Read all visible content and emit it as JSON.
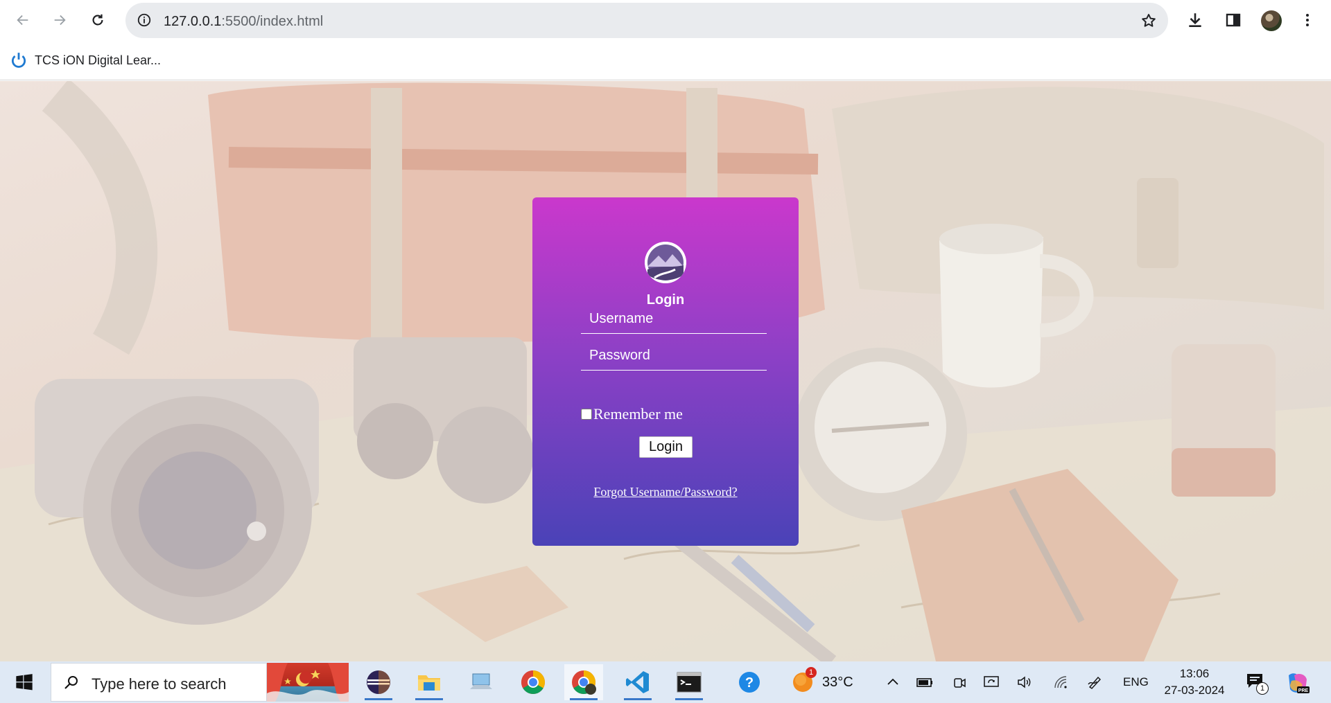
{
  "browser": {
    "url_host": "127.0.0.1",
    "url_rest": ":5500/index.html",
    "bookmark_label": "TCS iON Digital Lear..."
  },
  "login": {
    "title": "Login",
    "username_placeholder": "Username",
    "password_placeholder": "Password",
    "remember_label": "Remember me",
    "remember_checked": false,
    "button_label": "Login",
    "forgot_link": "Forgot Username/Password?",
    "card_gradient": [
      "#ca38cc",
      "#8d40c6",
      "#4a42b7"
    ]
  },
  "taskbar": {
    "search_placeholder": "Type here to search",
    "pinned_apps": [
      "eclipse-icon",
      "file-explorer-icon",
      "this-pc-icon",
      "chrome-icon",
      "chrome-profile-icon",
      "vscode-icon",
      "terminal-icon",
      "help-icon"
    ],
    "weather_badge": "1",
    "weather_temp": "33°C",
    "language": "ENG",
    "time": "13:06",
    "date": "27-03-2024",
    "notification_count": "1"
  }
}
